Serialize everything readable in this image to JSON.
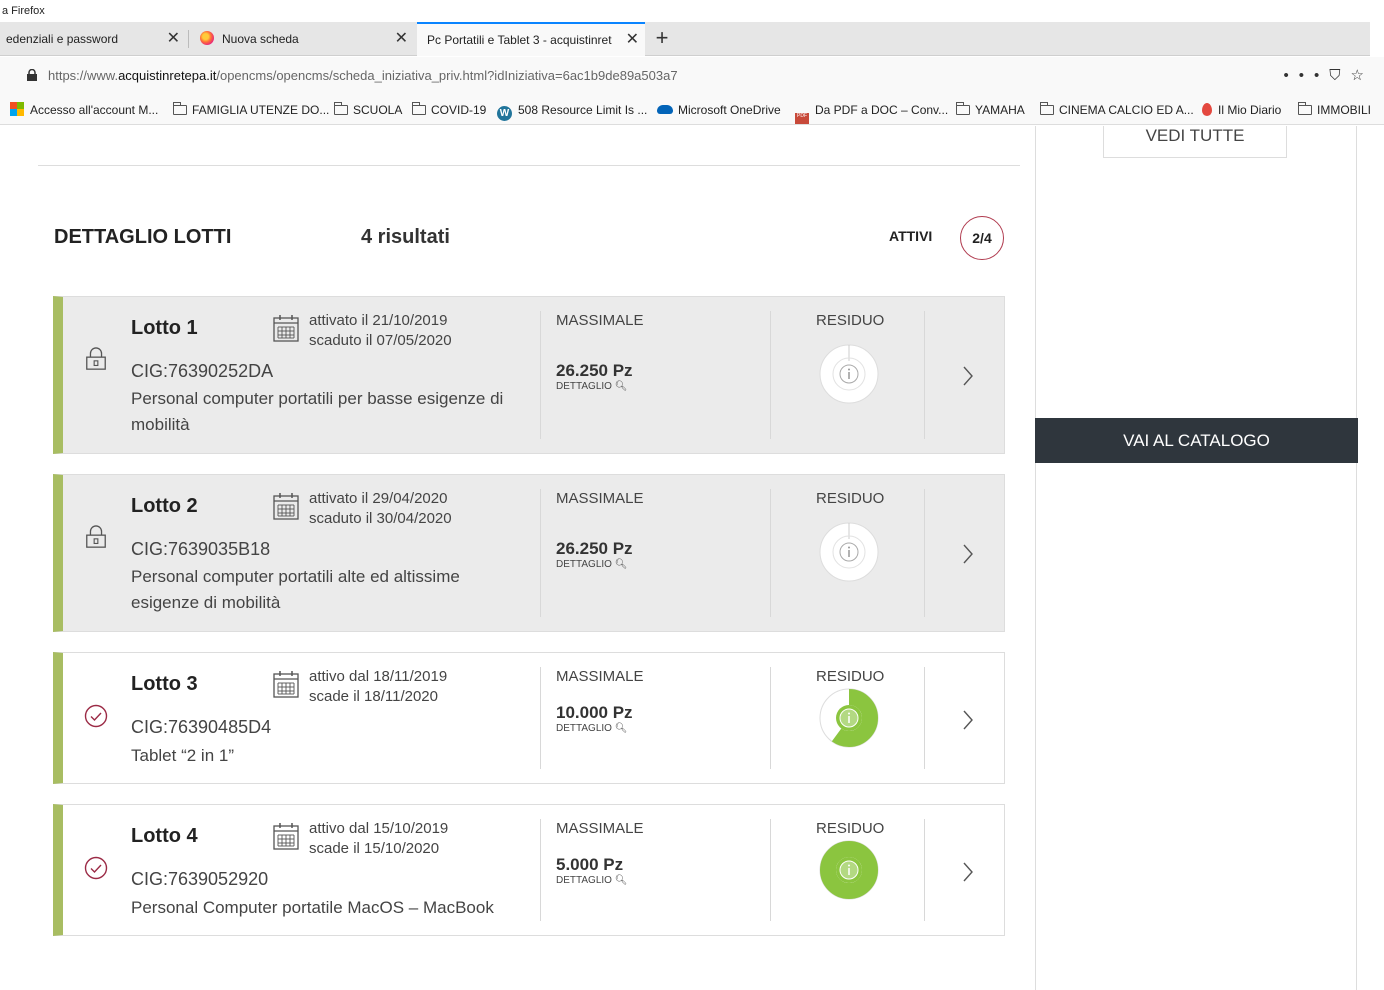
{
  "browser": {
    "title_fragment": "a Firefox",
    "tabs": [
      {
        "label": "edenziali e password",
        "active": false
      },
      {
        "label": "Nuova scheda",
        "active": false
      },
      {
        "label": "Pc Portatili e Tablet 3 - acquistinret",
        "active": true
      }
    ],
    "url": {
      "prefix": "https://www.",
      "domain": "acquistinretepa.it",
      "path": "/opencms/opencms/scheda_iniziativa_priv.html?idIniziativa=6ac1b9de89a503a7"
    },
    "bookmarks": [
      {
        "label": "Accesso all'account M...",
        "icon": "microsoft-icon"
      },
      {
        "label": "FAMIGLIA UTENZE DO...",
        "icon": "folder-icon"
      },
      {
        "label": "SCUOLA",
        "icon": "folder-icon"
      },
      {
        "label": "COVID-19",
        "icon": "folder-icon"
      },
      {
        "label": "508 Resource Limit Is ...",
        "icon": "wordpress-icon"
      },
      {
        "label": "Microsoft OneDrive",
        "icon": "onedrive-icon"
      },
      {
        "label": "Da PDF a DOC – Conv...",
        "icon": "pdf-icon"
      },
      {
        "label": "YAMAHA",
        "icon": "folder-icon"
      },
      {
        "label": "CINEMA CALCIO ED A...",
        "icon": "folder-icon"
      },
      {
        "label": "Il Mio Diario",
        "icon": "flame-icon"
      },
      {
        "label": "IMMOBILI",
        "icon": "folder-icon"
      }
    ]
  },
  "sidebar": {
    "vedi_tutte": "VEDI TUTTE",
    "catalogo_button": "VAI AL CATALOGO"
  },
  "section": {
    "title": "DETTAGLIO LOTTI",
    "results": "4 risultati",
    "filter_label": "ATTIVI",
    "pager": "2/4"
  },
  "lots": [
    {
      "title": "Lotto 1",
      "status": "expired",
      "date_line1": "attivato il 21/10/2019",
      "date_line2": "scaduto il 07/05/2020",
      "cig": "CIG:76390252DA",
      "description": "Personal computer portatili per basse esigenze di mobilità",
      "massimale_label": "MASSIMALE",
      "massimale_value": "26.250 Pz",
      "detail_link": "DETTAGLIO",
      "residuo_label": "RESIDUO",
      "residuo_fraction": 0
    },
    {
      "title": "Lotto 2",
      "status": "expired",
      "date_line1": "attivato il 29/04/2020",
      "date_line2": "scaduto il 30/04/2020",
      "cig": "CIG:7639035B18",
      "description": "Personal computer portatili alte ed altissime esigenze di mobilità",
      "massimale_label": "MASSIMALE",
      "massimale_value": "26.250 Pz",
      "detail_link": "DETTAGLIO",
      "residuo_label": "RESIDUO",
      "residuo_fraction": 0
    },
    {
      "title": "Lotto 3",
      "status": "active",
      "date_line1": "attivo dal 18/11/2019",
      "date_line2": "scade il 18/11/2020",
      "cig": "CIG:76390485D4",
      "description": "Tablet “2 in 1”",
      "massimale_label": "MASSIMALE",
      "massimale_value": "10.000 Pz",
      "detail_link": "DETTAGLIO",
      "residuo_label": "RESIDUO",
      "residuo_fraction": 0.6
    },
    {
      "title": "Lotto 4",
      "status": "active",
      "date_line1": "attivo dal 15/10/2019",
      "date_line2": "scade il 15/10/2020",
      "cig": "CIG:7639052920",
      "description": "Personal Computer portatile MacOS – MacBook",
      "massimale_label": "MASSIMALE",
      "massimale_value": "5.000 Pz",
      "detail_link": "DETTAGLIO",
      "residuo_label": "RESIDUO",
      "residuo_fraction": 1.0
    }
  ],
  "colors": {
    "accent_green": "#8bc53f",
    "card_border_green": "#a8bd62",
    "pager_border": "#b03a4e",
    "catalogo_bg": "#2f363d",
    "check_color": "#9b2a45"
  }
}
